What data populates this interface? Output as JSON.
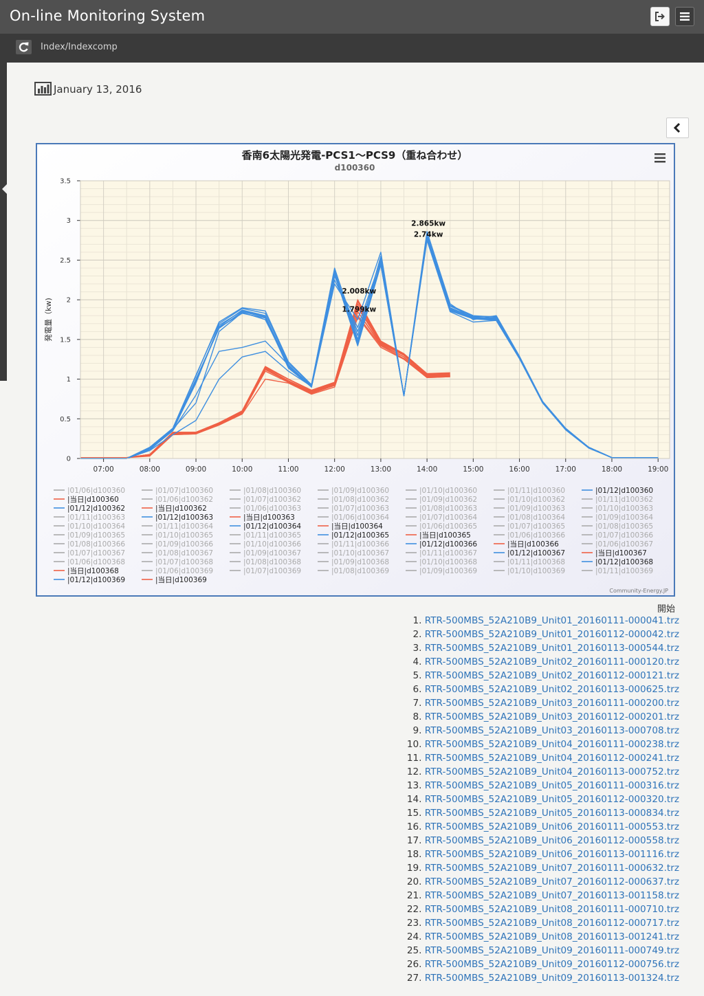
{
  "header": {
    "title": "On-line Monitoring System",
    "logout_icon": "logout-icon",
    "menu_icon": "hamburger-menu-icon"
  },
  "subheader": {
    "breadcrumb": "Index/Indexcomp",
    "refresh_icon": "refresh-icon"
  },
  "date": {
    "text": "January 13, 2016",
    "icon": "bar-chart-icon"
  },
  "colors": {
    "topbar": "#505050",
    "subbar": "#3a3a3a",
    "link": "#2f74b9",
    "series_blue": "#3f8fe0",
    "series_red": "#ef6045",
    "series_gray": "#aaaaaa",
    "frame": "#4a79b8"
  },
  "chart_data": {
    "type": "line",
    "title": "香南6太陽光発電-PCS1～PCS9（重ね合わせ）",
    "subtitle": "d100360",
    "ylabel": "発電量（kw)",
    "xlabel": "",
    "ylim": [
      0,
      3.5
    ],
    "yticks": [
      "0",
      "0.5",
      "1",
      "1.5",
      "2",
      "2.5",
      "3",
      "3.5"
    ],
    "xlim": [
      "06:30",
      "19:15"
    ],
    "xticks": [
      "07:00",
      "08:00",
      "09:00",
      "10:00",
      "11:00",
      "12:00",
      "13:00",
      "14:00",
      "15:00",
      "16:00",
      "17:00",
      "18:00",
      "19:00"
    ],
    "grid": true,
    "legend_position": "bottom",
    "annotations": [
      "2.865kw",
      "2.74kw",
      "2.008kw",
      "1.799kw"
    ],
    "credit": "Community-Energy.JP",
    "menu_icon": "chart-menu-icon",
    "x": [
      "06:30",
      "07:00",
      "07:30",
      "08:00",
      "08:30",
      "09:00",
      "09:30",
      "10:00",
      "10:30",
      "11:00",
      "11:30",
      "12:00",
      "12:30",
      "13:00",
      "13:30",
      "14:00",
      "14:30",
      "15:00",
      "15:30",
      "16:00",
      "16:30",
      "17:00",
      "17:30",
      "18:00",
      "18:30",
      "19:00"
    ],
    "series": [
      {
        "name": "|01/12|d100360",
        "kind": "blue",
        "values": [
          0,
          0,
          0,
          0.14,
          0.38,
          1.05,
          1.7,
          1.89,
          1.83,
          1.2,
          0.93,
          2.39,
          1.55,
          2.52,
          0.79,
          2.82,
          1.93,
          1.8,
          1.78,
          1.27,
          0.71,
          0.37,
          0.14,
          0.01,
          0.01,
          0.01
        ]
      },
      {
        "name": "|01/12|d100362",
        "kind": "blue",
        "values": [
          0,
          0,
          0,
          0.12,
          0.37,
          1.0,
          1.64,
          1.85,
          1.78,
          1.16,
          0.9,
          2.33,
          1.42,
          2.45,
          0.79,
          2.79,
          1.9,
          1.78,
          1.76,
          1.28,
          0.72,
          0.38,
          0.14,
          0.01,
          0.01,
          0.01
        ]
      },
      {
        "name": "|01/12|d100363",
        "kind": "blue",
        "values": [
          0,
          0,
          0,
          0.13,
          0.36,
          0.98,
          1.66,
          1.87,
          1.8,
          1.15,
          0.92,
          2.36,
          1.45,
          2.48,
          0.79,
          2.8,
          1.88,
          1.77,
          1.75,
          1.27,
          0.71,
          0.37,
          0.14,
          0.01,
          0.01,
          0.01
        ]
      },
      {
        "name": "|01/12|d100364",
        "kind": "blue",
        "values": [
          0,
          0,
          0,
          0.11,
          0.35,
          0.8,
          1.35,
          1.4,
          1.48,
          1.18,
          0.9,
          2.2,
          1.75,
          2.6,
          0.79,
          2.86,
          1.95,
          1.75,
          1.8,
          1.29,
          0.72,
          0.37,
          0.14,
          0.01,
          0.01,
          0.01
        ]
      },
      {
        "name": "|01/12|d100365",
        "kind": "blue",
        "values": [
          0,
          0,
          0,
          0.1,
          0.3,
          0.48,
          1.0,
          1.28,
          1.35,
          1.1,
          0.91,
          2.25,
          1.65,
          2.5,
          0.79,
          2.75,
          1.85,
          1.72,
          1.74,
          1.26,
          0.7,
          0.36,
          0.13,
          0.01,
          0.01,
          0.01
        ]
      },
      {
        "name": "|01/12|d100366",
        "kind": "blue",
        "values": [
          0,
          0,
          0,
          0.14,
          0.38,
          1.04,
          1.72,
          1.9,
          1.86,
          1.22,
          0.93,
          2.4,
          1.5,
          2.55,
          0.79,
          2.81,
          1.92,
          1.79,
          1.79,
          1.28,
          0.71,
          0.37,
          0.14,
          0.01,
          0.01,
          0.01
        ]
      },
      {
        "name": "|01/12|d100367",
        "kind": "blue",
        "values": [
          0,
          0,
          0,
          0.12,
          0.37,
          0.7,
          1.6,
          1.84,
          1.75,
          1.17,
          0.92,
          2.3,
          1.6,
          2.45,
          0.79,
          2.78,
          1.87,
          1.77,
          1.76,
          1.27,
          0.71,
          0.37,
          0.14,
          0.01,
          0.01,
          0.01
        ]
      },
      {
        "name": "|01/12|d100368",
        "kind": "blue",
        "values": [
          0,
          0,
          0,
          0.13,
          0.36,
          0.95,
          1.68,
          1.86,
          1.79,
          1.18,
          0.91,
          2.35,
          1.48,
          2.47,
          0.79,
          2.8,
          1.89,
          1.78,
          1.77,
          1.27,
          0.71,
          0.37,
          0.14,
          0.01,
          0.01,
          0.01
        ]
      },
      {
        "name": "|01/12|d100369",
        "kind": "blue",
        "values": [
          0,
          0,
          0,
          0.12,
          0.35,
          0.97,
          1.65,
          1.83,
          1.77,
          1.14,
          0.9,
          2.32,
          1.44,
          2.44,
          0.79,
          2.77,
          1.86,
          1.76,
          1.74,
          1.26,
          0.71,
          0.37,
          0.14,
          0.01,
          0.01,
          0.01
        ]
      },
      {
        "name": "|当日|d100360",
        "kind": "red",
        "values": [
          0.01,
          0.01,
          0.01,
          0.05,
          0.33,
          0.33,
          0.45,
          0.6,
          1.15,
          1.0,
          0.86,
          0.96,
          2.0,
          1.48,
          1.32,
          1.06,
          1.07
        ]
      },
      {
        "name": "|当日|d100362",
        "kind": "red",
        "values": [
          0.01,
          0.01,
          0.01,
          0.05,
          0.32,
          0.33,
          0.44,
          0.58,
          1.13,
          0.98,
          0.84,
          0.95,
          1.9,
          1.45,
          1.3,
          1.04,
          1.05
        ]
      },
      {
        "name": "|当日|d100363",
        "kind": "red",
        "values": [
          0.01,
          0.01,
          0.01,
          0.04,
          0.31,
          0.32,
          0.43,
          0.57,
          1.12,
          0.97,
          0.83,
          0.93,
          1.85,
          1.43,
          1.28,
          1.03,
          1.04
        ]
      },
      {
        "name": "|当日|d100364",
        "kind": "red",
        "values": [
          0.01,
          0.01,
          0.01,
          0.04,
          0.3,
          0.31,
          0.43,
          0.57,
          1.1,
          0.96,
          0.82,
          0.92,
          1.8,
          1.42,
          1.26,
          1.02,
          1.03
        ]
      },
      {
        "name": "|当日|d100365",
        "kind": "red",
        "values": [
          0.01,
          0.01,
          0.01,
          0.03,
          0.3,
          0.31,
          0.42,
          0.56,
          1.0,
          0.95,
          0.81,
          0.9,
          1.78,
          1.4,
          1.25,
          1.02,
          1.03
        ]
      },
      {
        "name": "|当日|d100366",
        "kind": "red",
        "values": [
          0.01,
          0.01,
          0.01,
          0.05,
          0.33,
          0.33,
          0.45,
          0.59,
          1.14,
          1.0,
          0.85,
          0.95,
          1.95,
          1.47,
          1.31,
          1.05,
          1.06
        ]
      },
      {
        "name": "|当日|d100367",
        "kind": "red",
        "values": [
          0.01,
          0.01,
          0.01,
          0.04,
          0.32,
          0.32,
          0.44,
          0.58,
          1.13,
          0.98,
          0.84,
          0.94,
          1.92,
          1.46,
          1.3,
          1.04,
          1.05
        ]
      },
      {
        "name": "|当日|d100368",
        "kind": "red",
        "values": [
          0.01,
          0.01,
          0.01,
          0.05,
          0.33,
          0.33,
          0.45,
          0.6,
          1.16,
          1.0,
          0.86,
          0.96,
          1.98,
          1.48,
          1.32,
          1.07,
          1.08
        ]
      },
      {
        "name": "|当日|d100369",
        "kind": "red",
        "values": [
          0.01,
          0.01,
          0.01,
          0.04,
          0.31,
          0.32,
          0.44,
          0.58,
          1.12,
          0.97,
          0.83,
          0.93,
          1.85,
          1.44,
          1.28,
          1.03,
          1.04
        ]
      }
    ],
    "legend_items": [
      {
        "name": "|01/06|d100360",
        "kind": "gray"
      },
      {
        "name": "|01/07|d100360",
        "kind": "gray"
      },
      {
        "name": "|01/08|d100360",
        "kind": "gray"
      },
      {
        "name": "|01/09|d100360",
        "kind": "gray"
      },
      {
        "name": "|01/10|d100360",
        "kind": "gray"
      },
      {
        "name": "|01/11|d100360",
        "kind": "gray"
      },
      {
        "name": "|01/12|d100360",
        "kind": "blue"
      },
      {
        "name": "|当日|d100360",
        "kind": "red"
      },
      {
        "name": "|01/06|d100362",
        "kind": "gray"
      },
      {
        "name": "|01/07|d100362",
        "kind": "gray"
      },
      {
        "name": "|01/08|d100362",
        "kind": "gray"
      },
      {
        "name": "|01/09|d100362",
        "kind": "gray"
      },
      {
        "name": "|01/10|d100362",
        "kind": "gray"
      },
      {
        "name": "|01/11|d100362",
        "kind": "gray"
      },
      {
        "name": "|01/12|d100362",
        "kind": "blue"
      },
      {
        "name": "|当日|d100362",
        "kind": "red"
      },
      {
        "name": "|01/06|d100363",
        "kind": "gray"
      },
      {
        "name": "|01/07|d100363",
        "kind": "gray"
      },
      {
        "name": "|01/08|d100363",
        "kind": "gray"
      },
      {
        "name": "|01/09|d100363",
        "kind": "gray"
      },
      {
        "name": "|01/10|d100363",
        "kind": "gray"
      },
      {
        "name": "|01/11|d100363",
        "kind": "gray"
      },
      {
        "name": "|01/12|d100363",
        "kind": "blue"
      },
      {
        "name": "|当日|d100363",
        "kind": "red"
      },
      {
        "name": "|01/06|d100364",
        "kind": "gray"
      },
      {
        "name": "|01/07|d100364",
        "kind": "gray"
      },
      {
        "name": "|01/08|d100364",
        "kind": "gray"
      },
      {
        "name": "|01/09|d100364",
        "kind": "gray"
      },
      {
        "name": "|01/10|d100364",
        "kind": "gray"
      },
      {
        "name": "|01/11|d100364",
        "kind": "gray"
      },
      {
        "name": "|01/12|d100364",
        "kind": "blue"
      },
      {
        "name": "|当日|d100364",
        "kind": "red"
      },
      {
        "name": "|01/06|d100365",
        "kind": "gray"
      },
      {
        "name": "|01/07|d100365",
        "kind": "gray"
      },
      {
        "name": "|01/08|d100365",
        "kind": "gray"
      },
      {
        "name": "|01/09|d100365",
        "kind": "gray"
      },
      {
        "name": "|01/10|d100365",
        "kind": "gray"
      },
      {
        "name": "|01/11|d100365",
        "kind": "gray"
      },
      {
        "name": "|01/12|d100365",
        "kind": "blue"
      },
      {
        "name": "|当日|d100365",
        "kind": "red"
      },
      {
        "name": "|01/06|d100366",
        "kind": "gray"
      },
      {
        "name": "|01/07|d100366",
        "kind": "gray"
      },
      {
        "name": "|01/08|d100366",
        "kind": "gray"
      },
      {
        "name": "|01/09|d100366",
        "kind": "gray"
      },
      {
        "name": "|01/10|d100366",
        "kind": "gray"
      },
      {
        "name": "|01/11|d100366",
        "kind": "gray"
      },
      {
        "name": "|01/12|d100366",
        "kind": "blue"
      },
      {
        "name": "|当日|d100366",
        "kind": "red"
      },
      {
        "name": "|01/06|d100367",
        "kind": "gray"
      },
      {
        "name": "|01/07|d100367",
        "kind": "gray"
      },
      {
        "name": "|01/08|d100367",
        "kind": "gray"
      },
      {
        "name": "|01/09|d100367",
        "kind": "gray"
      },
      {
        "name": "|01/10|d100367",
        "kind": "gray"
      },
      {
        "name": "|01/11|d100367",
        "kind": "gray"
      },
      {
        "name": "|01/12|d100367",
        "kind": "blue"
      },
      {
        "name": "|当日|d100367",
        "kind": "red"
      },
      {
        "name": "|01/06|d100368",
        "kind": "gray"
      },
      {
        "name": "|01/07|d100368",
        "kind": "gray"
      },
      {
        "name": "|01/08|d100368",
        "kind": "gray"
      },
      {
        "name": "|01/09|d100368",
        "kind": "gray"
      },
      {
        "name": "|01/10|d100368",
        "kind": "gray"
      },
      {
        "name": "|01/11|d100368",
        "kind": "gray"
      },
      {
        "name": "|01/12|d100368",
        "kind": "blue"
      },
      {
        "name": "|当日|d100368",
        "kind": "red"
      },
      {
        "name": "|01/06|d100369",
        "kind": "gray"
      },
      {
        "name": "|01/07|d100369",
        "kind": "gray"
      },
      {
        "name": "|01/08|d100369",
        "kind": "gray"
      },
      {
        "name": "|01/09|d100369",
        "kind": "gray"
      },
      {
        "name": "|01/10|d100369",
        "kind": "gray"
      },
      {
        "name": "|01/11|d100369",
        "kind": "gray"
      },
      {
        "name": "|01/12|d100369",
        "kind": "blue"
      },
      {
        "name": "|当日|d100369",
        "kind": "red"
      }
    ]
  },
  "files": {
    "header": "開始",
    "items": [
      "RTR-500MBS_52A210B9_Unit01_20160111-000041.trz",
      "RTR-500MBS_52A210B9_Unit01_20160112-000042.trz",
      "RTR-500MBS_52A210B9_Unit01_20160113-000544.trz",
      "RTR-500MBS_52A210B9_Unit02_20160111-000120.trz",
      "RTR-500MBS_52A210B9_Unit02_20160112-000121.trz",
      "RTR-500MBS_52A210B9_Unit02_20160113-000625.trz",
      "RTR-500MBS_52A210B9_Unit03_20160111-000200.trz",
      "RTR-500MBS_52A210B9_Unit03_20160112-000201.trz",
      "RTR-500MBS_52A210B9_Unit03_20160113-000708.trz",
      "RTR-500MBS_52A210B9_Unit04_20160111-000238.trz",
      "RTR-500MBS_52A210B9_Unit04_20160112-000241.trz",
      "RTR-500MBS_52A210B9_Unit04_20160113-000752.trz",
      "RTR-500MBS_52A210B9_Unit05_20160111-000316.trz",
      "RTR-500MBS_52A210B9_Unit05_20160112-000320.trz",
      "RTR-500MBS_52A210B9_Unit05_20160113-000834.trz",
      "RTR-500MBS_52A210B9_Unit06_20160111-000553.trz",
      "RTR-500MBS_52A210B9_Unit06_20160112-000558.trz",
      "RTR-500MBS_52A210B9_Unit06_20160113-001116.trz",
      "RTR-500MBS_52A210B9_Unit07_20160111-000632.trz",
      "RTR-500MBS_52A210B9_Unit07_20160112-000637.trz",
      "RTR-500MBS_52A210B9_Unit07_20160113-001158.trz",
      "RTR-500MBS_52A210B9_Unit08_20160111-000710.trz",
      "RTR-500MBS_52A210B9_Unit08_20160112-000717.trz",
      "RTR-500MBS_52A210B9_Unit08_20160113-001241.trz",
      "RTR-500MBS_52A210B9_Unit09_20160111-000749.trz",
      "RTR-500MBS_52A210B9_Unit09_20160112-000756.trz",
      "RTR-500MBS_52A210B9_Unit09_20160113-001324.trz"
    ]
  }
}
